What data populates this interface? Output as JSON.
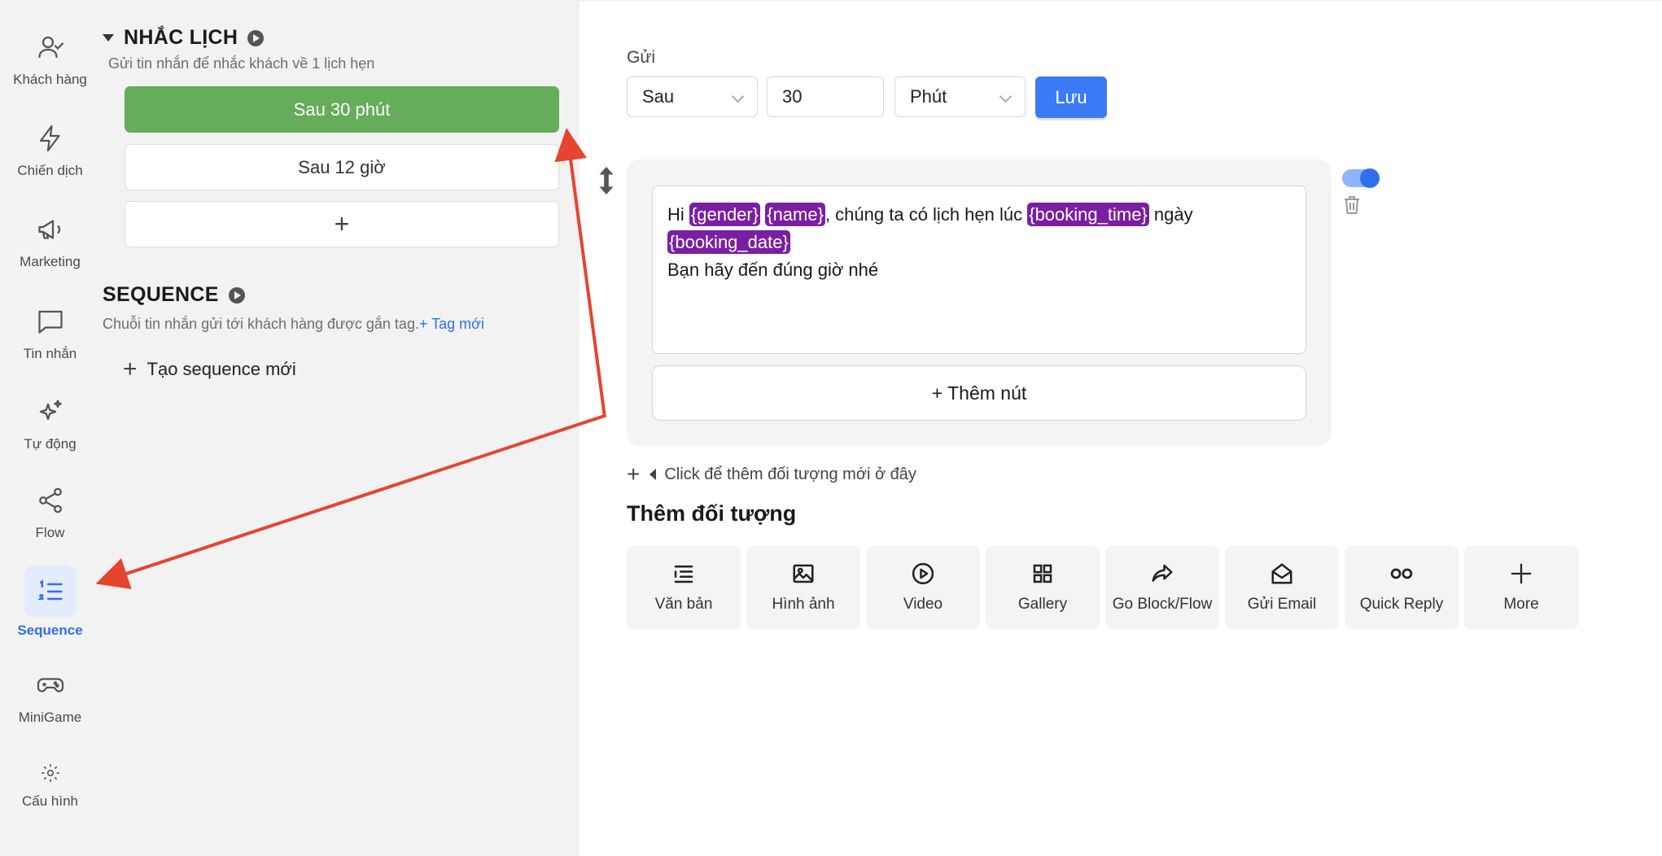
{
  "colors": {
    "accent": "#2f6fed",
    "active_reminder": "#66ad5b",
    "tag": "#7b1fa2",
    "arrow": "#e5452f"
  },
  "nav": {
    "items": [
      {
        "label": "Khách hàng",
        "icon": "user-check-icon"
      },
      {
        "label": "Chiến dịch",
        "icon": "lightning-icon"
      },
      {
        "label": "Marketing",
        "icon": "megaphone-icon"
      },
      {
        "label": "Tin nhắn",
        "icon": "message-icon"
      },
      {
        "label": "Tự động",
        "icon": "sparkle-icon"
      },
      {
        "label": "Flow",
        "icon": "share-icon"
      },
      {
        "label": "Sequence",
        "icon": "numbered-list-icon",
        "active": true
      },
      {
        "label": "MiniGame",
        "icon": "gamepad-icon"
      },
      {
        "label": "Cấu hình",
        "icon": "gear-icon"
      }
    ]
  },
  "panel": {
    "reminder": {
      "title": "NHẮC LỊCH",
      "description": "Gửi tin nhắn để nhắc khách về 1 lịch hẹn",
      "items": [
        "Sau 30 phút",
        "Sau 12 giờ"
      ],
      "add_label": "+"
    },
    "sequence": {
      "title": "SEQUENCE",
      "description": "Chuỗi tin nhắn gửi tới khách hàng được gắn tag.",
      "new_tag_link": "+ Tag mới",
      "create_label": "Tạo sequence mới"
    }
  },
  "main": {
    "send_label": "Gửi",
    "timing": {
      "type": "Sau",
      "amount": "30",
      "unit": "Phút"
    },
    "save_label": "Lưu",
    "message": {
      "greeting": "Hi ",
      "tag_gender": "{gender}",
      "tag_name": "{name}",
      "text1": ", chúng ta có lịch hẹn lúc ",
      "tag_booking_time": "{booking_time}",
      "text2": " ngày",
      "tag_booking_date": "{booking_date}",
      "line2": "Bạn hãy đến đúng giờ nhé"
    },
    "add_button_label": "+ Thêm nút",
    "toggle_on": true,
    "hint": "Click để thêm đối tượng mới ở đây",
    "add_object_title": "Thêm đối tượng",
    "objects": [
      {
        "label": "Văn bản",
        "icon": "text-list-icon"
      },
      {
        "label": "Hình ảnh",
        "icon": "image-icon"
      },
      {
        "label": "Video",
        "icon": "play-circle-icon"
      },
      {
        "label": "Gallery",
        "icon": "grid-icon"
      },
      {
        "label": "Go Block/Flow",
        "icon": "forward-arrow-icon"
      },
      {
        "label": "Gửi Email",
        "icon": "envelope-open-icon"
      },
      {
        "label": "Quick Reply",
        "icon": "double-circle-icon"
      },
      {
        "label": "More",
        "icon": "plus-icon"
      }
    ]
  }
}
